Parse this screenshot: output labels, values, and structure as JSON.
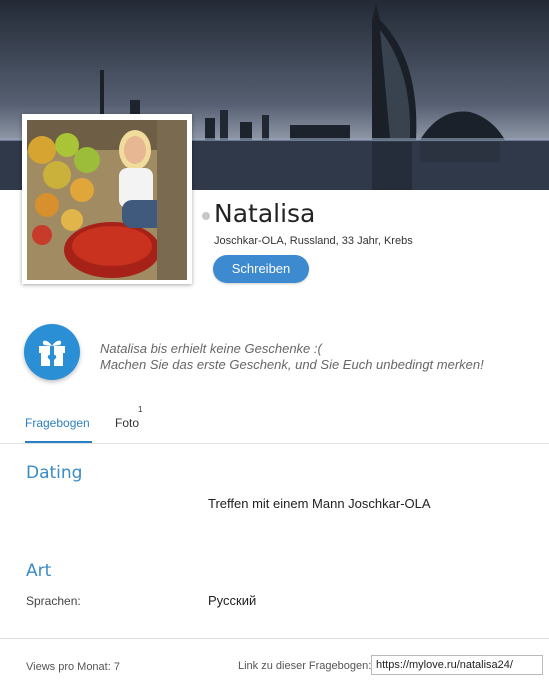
{
  "profile": {
    "name": "Natalisa",
    "meta": "Joschkar-OLA, Russland, 33 Jahr, Krebs",
    "write_label": "Schreiben",
    "online_status": "offline"
  },
  "gifts": {
    "line1": "Natalisa bis erhielt keine Geschenke :(",
    "line2": "Machen Sie das erste Geschenk, und Sie Euch unbedingt merken!"
  },
  "tabs": [
    {
      "label": "Fragebogen",
      "active": true
    },
    {
      "label": "Foto",
      "count": "1",
      "active": false
    }
  ],
  "sections": {
    "dating": {
      "title": "Dating",
      "value": "Treffen mit einem Mann Joschkar-OLA"
    },
    "art": {
      "title": "Art",
      "languages_label": "Sprachen:",
      "languages_value": "Русский"
    }
  },
  "footer": {
    "views": "Views pro Monat: 7",
    "link_label": "Link zu dieser Fragebogen:",
    "link_value": "https://mylove.ru/natalisa24/"
  },
  "colors": {
    "accent": "#3d8ad0",
    "section_title": "#3a8bc6",
    "gift_circle": "#2b8fd6"
  }
}
